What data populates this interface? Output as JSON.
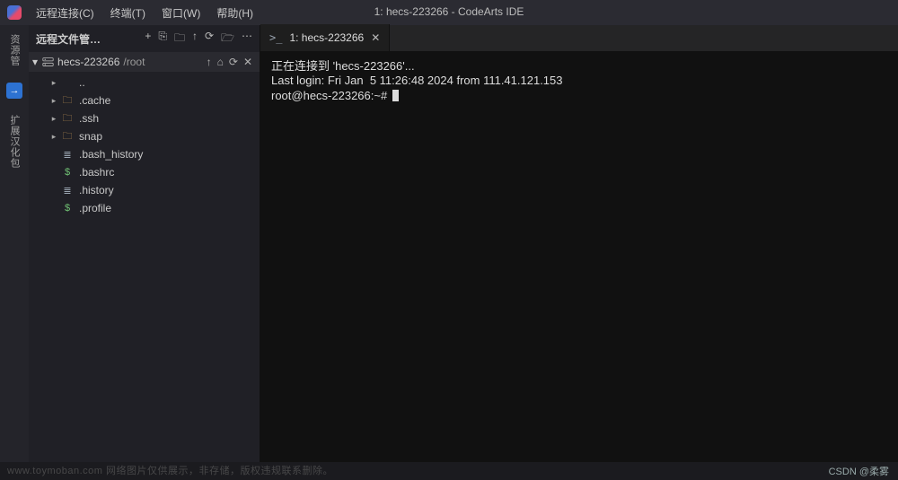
{
  "window": {
    "title": "1: hecs-223266 - CodeArts IDE"
  },
  "menubar": {
    "items": [
      "远程连接(C)",
      "终端(T)",
      "窗口(W)",
      "帮助(H)"
    ]
  },
  "activitybar": {
    "items": [
      "资源管",
      "扩展汉化包"
    ],
    "badge": "→"
  },
  "sidebar": {
    "title": "远程文件管…",
    "actions": {
      "add": "+",
      "newfile": "⎘",
      "newfolder": "🗀",
      "up": "↑",
      "refresh": "⟳",
      "openfolder": "🗁",
      "more": "⋯"
    },
    "server": {
      "name": "hecs-223266",
      "path": "/root"
    },
    "subactions": {
      "up": "↑",
      "home": "⌂",
      "refresh": "⟳",
      "close": "✕"
    },
    "tree": [
      {
        "icon": "chev",
        "chev": "▸",
        "iconclass": "ic-folder",
        "glyph": "",
        "name": ".."
      },
      {
        "icon": "folder",
        "chev": "▸",
        "iconclass": "ic-folder",
        "glyph": "🗀",
        "name": ".cache"
      },
      {
        "icon": "folder",
        "chev": "▸",
        "iconclass": "ic-folder",
        "glyph": "🗀",
        "name": ".ssh"
      },
      {
        "icon": "folder",
        "chev": "▸",
        "iconclass": "ic-folder",
        "glyph": "🗀",
        "name": "snap"
      },
      {
        "icon": "file",
        "chev": "",
        "iconclass": "ic-lines",
        "glyph": "≣",
        "name": ".bash_history"
      },
      {
        "icon": "file",
        "chev": "",
        "iconclass": "ic-dollar",
        "glyph": "$",
        "name": ".bashrc"
      },
      {
        "icon": "file",
        "chev": "",
        "iconclass": "ic-lines",
        "glyph": "≣",
        "name": ".history"
      },
      {
        "icon": "file",
        "chev": "",
        "iconclass": "ic-dollar",
        "glyph": "$",
        "name": ".profile"
      }
    ]
  },
  "tab": {
    "icon": ">_",
    "label": "1: hecs-223266"
  },
  "terminal": {
    "lines": [
      "正在连接到 'hecs-223266'...",
      "Last login: Fri Jan  5 11:26:48 2024 from 111.41.121.153",
      "root@hecs-223266:~# "
    ]
  },
  "statusbar": {
    "right": "CSDN @柔雾"
  },
  "watermark": "www.toymoban.com 网络图片仅供展示，非存储，版权违规联系删除。"
}
